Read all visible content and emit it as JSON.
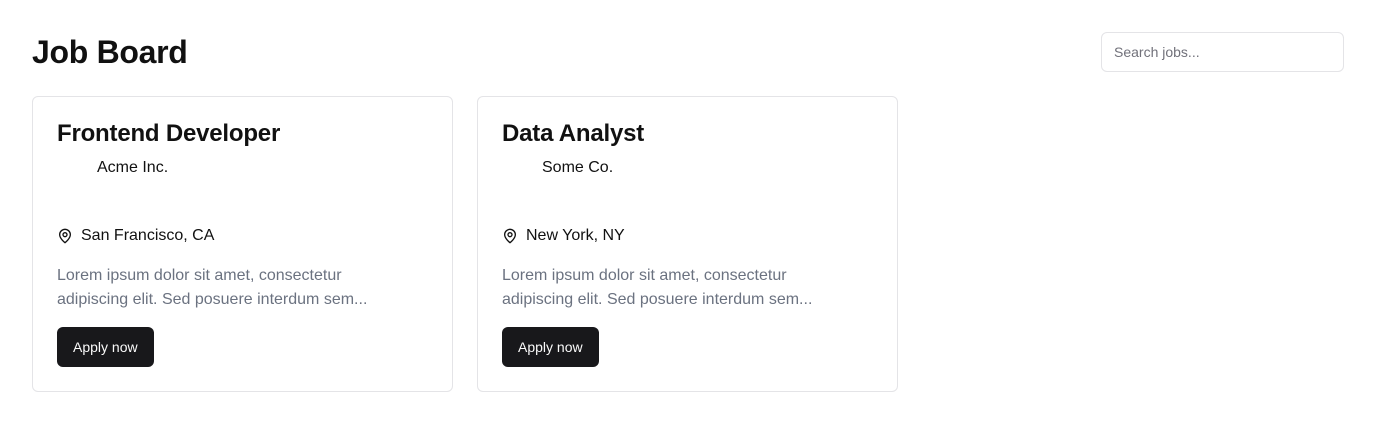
{
  "header": {
    "title": "Job Board",
    "search_placeholder": "Search jobs..."
  },
  "jobs": [
    {
      "title": "Frontend Developer",
      "company": "Acme Inc.",
      "location": "San Francisco, CA",
      "description": "Lorem ipsum dolor sit amet, consectetur adipiscing elit. Sed posuere interdum sem...",
      "apply_label": "Apply now"
    },
    {
      "title": "Data Analyst",
      "company": "Some Co.",
      "location": "New York, NY",
      "description": "Lorem ipsum dolor sit amet, consectetur adipiscing elit. Sed posuere interdum sem...",
      "apply_label": "Apply now"
    }
  ],
  "icons": {
    "location": "map-pin-icon"
  },
  "colors": {
    "button_bg": "#18181b",
    "button_text": "#fafafa",
    "muted_text": "#6b7280",
    "border": "#e4e4e7"
  }
}
